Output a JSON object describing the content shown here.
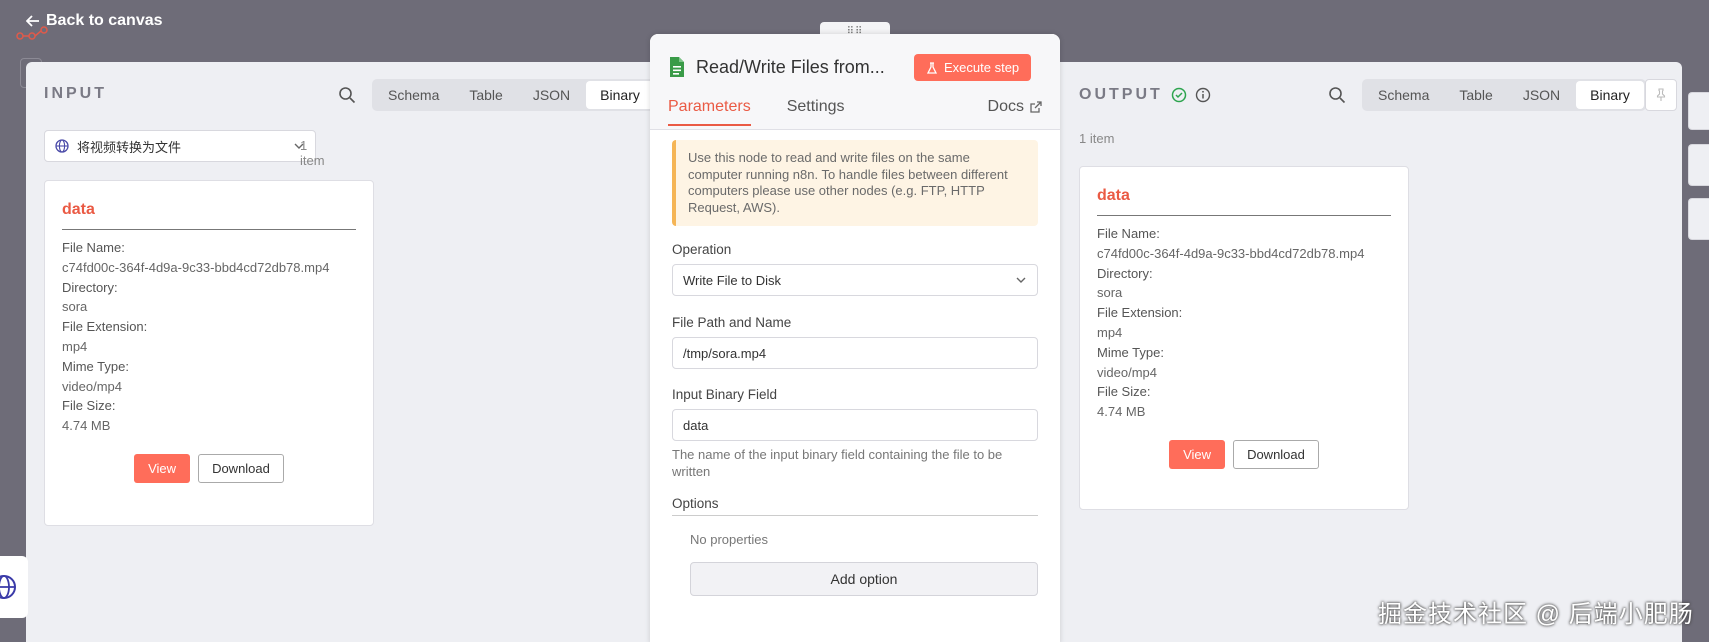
{
  "back_label": "Back to canvas",
  "drag_handle": "⠿⠿",
  "input": {
    "title": "INPUT",
    "tabs": [
      "Schema",
      "Table",
      "JSON",
      "Binary"
    ],
    "active_tab": "Binary",
    "select_value": "将视频转换为文件",
    "item_count": "1 item",
    "card": {
      "name": "data",
      "rows": [
        {
          "label": "File Name:",
          "value": "c74fd00c-364f-4d9a-9c33-bbd4cd72db78.mp4"
        },
        {
          "label": "Directory:",
          "value": "sora"
        },
        {
          "label": "File Extension:",
          "value": "mp4"
        },
        {
          "label": "Mime Type:",
          "value": "video/mp4"
        },
        {
          "label": "File Size:",
          "value": "4.74 MB"
        }
      ],
      "view_label": "View",
      "download_label": "Download"
    }
  },
  "node": {
    "title": "Read/Write Files from...",
    "execute_label": "Execute step",
    "tabs": [
      "Parameters",
      "Settings"
    ],
    "active_tab": "Parameters",
    "docs_label": "Docs",
    "notice": "Use this node to read and write files on the same computer running n8n. To handle files between different computers please use other nodes (e.g. FTP, HTTP Request, AWS).",
    "operation_label": "Operation",
    "operation_value": "Write File to Disk",
    "path_label": "File Path and Name",
    "path_value": "/tmp/sora.mp4",
    "binary_label": "Input Binary Field",
    "binary_value": "data",
    "binary_hint": "The name of the input binary field containing the file to be written",
    "options_label": "Options",
    "no_properties": "No properties",
    "add_option_label": "Add option"
  },
  "output": {
    "title": "OUTPUT",
    "tabs": [
      "Schema",
      "Table",
      "JSON",
      "Binary"
    ],
    "active_tab": "Binary",
    "item_count": "1 item",
    "card": {
      "name": "data",
      "rows": [
        {
          "label": "File Name:",
          "value": "c74fd00c-364f-4d9a-9c33-bbd4cd72db78.mp4"
        },
        {
          "label": "Directory:",
          "value": "sora"
        },
        {
          "label": "File Extension:",
          "value": "mp4"
        },
        {
          "label": "Mime Type:",
          "value": "video/mp4"
        },
        {
          "label": "File Size:",
          "value": "4.74 MB"
        }
      ],
      "view_label": "View",
      "download_label": "Download"
    }
  },
  "watermark": "掘金技术社区 @ 后端小肥肠",
  "colors": {
    "accent": "#ff6d5a",
    "success": "#2da44e",
    "notice_border": "#f5b556"
  }
}
